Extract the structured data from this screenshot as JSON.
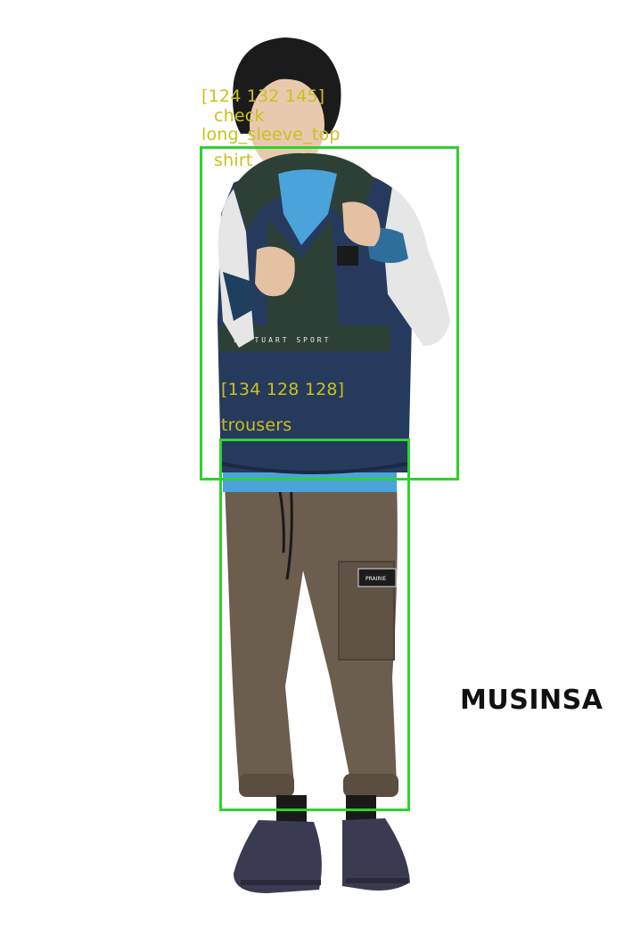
{
  "photo": {
    "brand_watermark": "MUSINSA",
    "garment_print": "LE TUART SPORT",
    "pocket_patch": "PRAIRIE"
  },
  "detections": [
    {
      "id": "top",
      "color_label": "[124 132 145]",
      "labels": [
        "check",
        "long_sleeve_top",
        "shirt"
      ]
    },
    {
      "id": "bottom",
      "color_label": "[134 128 128]",
      "labels": [
        "trousers"
      ]
    }
  ],
  "colors": {
    "box": "#2fd12f",
    "label": "#c9c21a",
    "jacket": "#263a5e",
    "shirt": "#4aa3d9",
    "pants": "#6b5e4f"
  }
}
